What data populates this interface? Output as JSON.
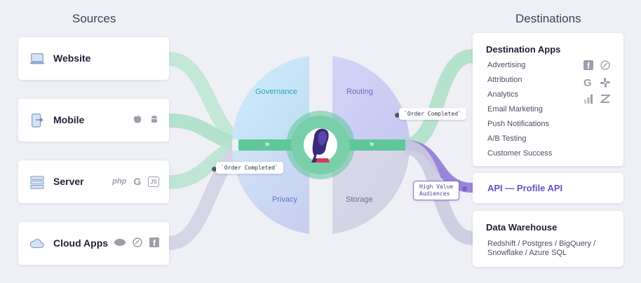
{
  "titles": {
    "sources": "Sources",
    "destinations": "Destinations"
  },
  "sources": [
    {
      "label": "Website",
      "logos": []
    },
    {
      "label": "Mobile",
      "logos": [
        "apple-icon",
        "android-icon"
      ]
    },
    {
      "label": "Server",
      "logos": [
        "php",
        "G",
        "JS"
      ]
    },
    {
      "label": "Cloud Apps",
      "logos": [
        "salesforce-icon",
        "zendesk-icon",
        "f"
      ]
    }
  ],
  "hub": {
    "quadrants": [
      "Governance",
      "Routing",
      "Privacy",
      "Storage"
    ],
    "colors": {
      "governance": "#2e9fc9",
      "routing": "#6c6cc4",
      "privacy": "#5a74c8",
      "storage": "#6e7088",
      "green": "#5fc79a",
      "purple": "#6e4fbf"
    }
  },
  "events": {
    "order_left": "`Order Completed`",
    "order_right": "`Order Completed`",
    "high_value": "High Value\nAudiences"
  },
  "destinations": {
    "apps": {
      "title": "Destination Apps",
      "items": [
        "Advertising",
        "Attribution",
        "Analytics",
        "Email Marketing",
        "Push Notifications",
        "A/B Testing",
        "Customer Success"
      ],
      "logos": [
        "f",
        "attribution-icon",
        "G",
        "slack-icon",
        "bar-chart-icon",
        "zendesk-icon"
      ]
    },
    "api": {
      "title": "API — Profile API"
    },
    "warehouse": {
      "title": "Data Warehouse",
      "desc": "Redshift / Postgres / BigQuery /\nSnowflake / Azure SQL"
    }
  }
}
